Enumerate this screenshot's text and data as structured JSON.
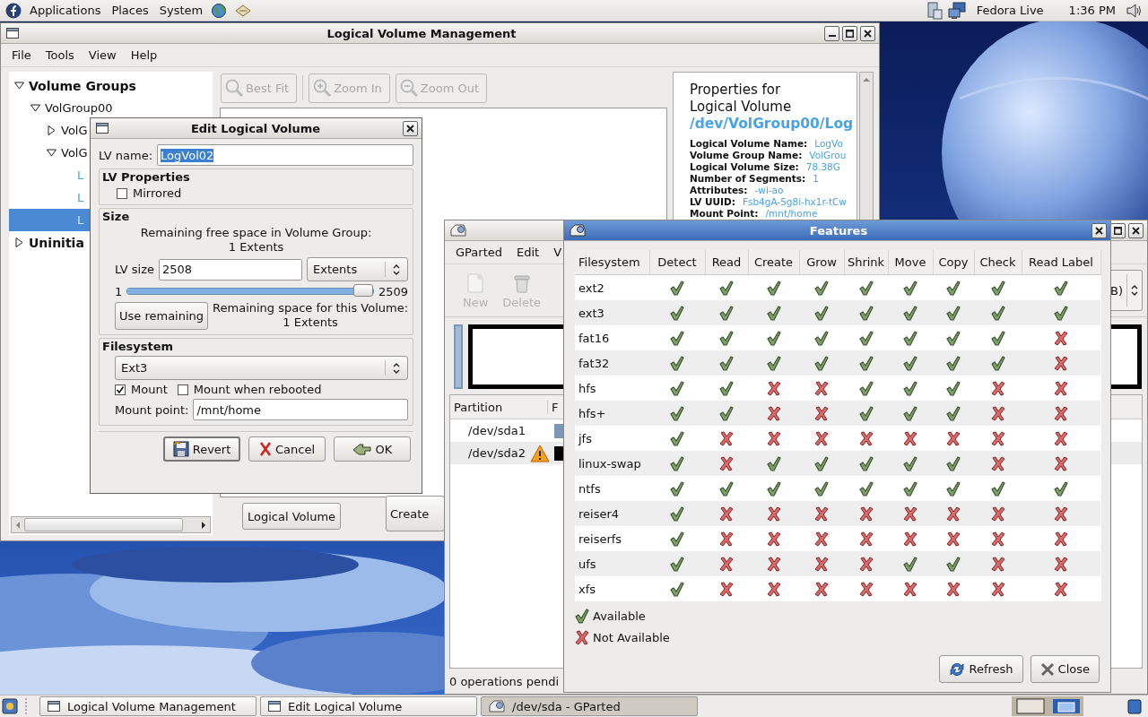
{
  "top_panel": {
    "menus": [
      "Applications",
      "Places",
      "System"
    ],
    "user": "Fedora Live",
    "clock": "1:36 PM"
  },
  "lvm_window": {
    "title": "Logical Volume Management",
    "menu": [
      "File",
      "Tools",
      "View",
      "Help"
    ],
    "tree": [
      {
        "label": "Volume Groups",
        "kind": "category",
        "expanded": true,
        "selected": false,
        "children": [
          {
            "label": "VolGroup00",
            "kind": "group",
            "expanded": true,
            "selected": false,
            "children": [
              {
                "label": "VolG",
                "kind": "group",
                "expanded": false,
                "selected": false
              },
              {
                "label": "VolG",
                "kind": "group",
                "expanded": true,
                "selected": false,
                "children": [
                  {
                    "label": "L",
                    "kind": "volume",
                    "selected": false
                  },
                  {
                    "label": "L",
                    "kind": "volume",
                    "selected": false
                  },
                  {
                    "label": "L",
                    "kind": "volume",
                    "selected": true
                  }
                ]
              }
            ]
          }
        ]
      },
      {
        "label": "Uninitia",
        "kind": "category",
        "expanded": false,
        "selected": false
      }
    ],
    "toolbar": [
      {
        "label": "Best Fit",
        "disabled": true
      },
      {
        "label": "Zoom In",
        "disabled": true
      },
      {
        "label": "Zoom Out",
        "disabled": true
      }
    ],
    "properties": {
      "heading_lines": [
        "Properties for",
        "Logical Volume"
      ],
      "path": "/dev/VolGroup00/Log",
      "fields": [
        {
          "label": "Logical Volume Name:",
          "value": "LogVo"
        },
        {
          "label": "Volume Group Name:",
          "value": "VolGrou"
        },
        {
          "label": "Logical Volume Size:",
          "value": "78.38G"
        },
        {
          "label": "Number of Segments:",
          "value": "1"
        },
        {
          "label": "Attributes:",
          "value": "-wi-ao"
        },
        {
          "label": "LV UUID:",
          "value": "Fsb4gA-5g8i-hx1r-tCw"
        },
        {
          "label": "Mount Point:",
          "value": "/mnt/home"
        }
      ]
    },
    "buttons": [
      "Logical Volume",
      "Create"
    ]
  },
  "edit_dialog": {
    "title": "Edit Logical Volume",
    "lv_name_label": "LV name:",
    "lv_name": "LogVol02",
    "properties_heading": "LV Properties",
    "mirrored": {
      "label": "Mirrored",
      "checked": false
    },
    "size_heading": "Size",
    "free_space": [
      "Remaining free space in Volume Group:",
      "1 Extents"
    ],
    "lv_size_label": "LV size",
    "lv_size": "2508",
    "unit": "Extents",
    "slider_min": "1",
    "slider_max": "2509",
    "level": 1,
    "use_remaining": "Use remaining",
    "remaining_space": [
      "Remaining space for this Volume:",
      "1 Extents"
    ],
    "filesystem_heading": "Filesystem",
    "filesystem": "Ext3",
    "mount": {
      "label": "Mount",
      "checked": true
    },
    "mount_reboot": {
      "label": "Mount when rebooted",
      "checked": false
    },
    "mount_point_label": "Mount point:",
    "mount_point": "/mnt/home",
    "buttons": [
      "Revert",
      "Cancel",
      "OK"
    ]
  },
  "gparted_window": {
    "menu": [
      "GParted",
      "Edit",
      "V"
    ],
    "toolbar": [
      {
        "label": "New",
        "disabled": true
      },
      {
        "label": "Delete",
        "disabled": true
      }
    ],
    "device_combo": "B)",
    "columns": [
      "Partition",
      "F"
    ],
    "partitions": [
      {
        "name": "/dev/sda1",
        "warning": false,
        "color": "#7b96b8"
      },
      {
        "name": "/dev/sda2",
        "warning": true,
        "color": "#000000"
      }
    ],
    "status": "0 operations pendi"
  },
  "features_dialog": {
    "title": "Features",
    "columns": [
      "Filesystem",
      "Detect",
      "Read",
      "Create",
      "Grow",
      "Shrink",
      "Move",
      "Copy",
      "Check",
      "Read Label"
    ],
    "rows": [
      {
        "filesystem": "ext2",
        "available": [
          true,
          true,
          true,
          true,
          true,
          true,
          true,
          true,
          true
        ]
      },
      {
        "filesystem": "ext3",
        "available": [
          true,
          true,
          true,
          true,
          true,
          true,
          true,
          true,
          true
        ]
      },
      {
        "filesystem": "fat16",
        "available": [
          true,
          true,
          true,
          true,
          true,
          true,
          true,
          true,
          false
        ]
      },
      {
        "filesystem": "fat32",
        "available": [
          true,
          true,
          true,
          true,
          true,
          true,
          true,
          true,
          false
        ]
      },
      {
        "filesystem": "hfs",
        "available": [
          true,
          true,
          false,
          false,
          true,
          true,
          true,
          false,
          false
        ]
      },
      {
        "filesystem": "hfs+",
        "available": [
          true,
          true,
          false,
          false,
          true,
          true,
          true,
          false,
          false
        ]
      },
      {
        "filesystem": "jfs",
        "available": [
          true,
          false,
          false,
          false,
          false,
          false,
          false,
          false,
          false
        ]
      },
      {
        "filesystem": "linux-swap",
        "available": [
          true,
          false,
          true,
          true,
          true,
          true,
          true,
          false,
          false
        ]
      },
      {
        "filesystem": "ntfs",
        "available": [
          true,
          true,
          true,
          true,
          true,
          true,
          true,
          true,
          true
        ]
      },
      {
        "filesystem": "reiser4",
        "available": [
          true,
          false,
          false,
          false,
          false,
          false,
          false,
          false,
          false
        ]
      },
      {
        "filesystem": "reiserfs",
        "available": [
          true,
          false,
          false,
          false,
          false,
          false,
          false,
          false,
          false
        ]
      },
      {
        "filesystem": "ufs",
        "available": [
          true,
          false,
          false,
          false,
          false,
          true,
          true,
          false,
          false
        ]
      },
      {
        "filesystem": "xfs",
        "available": [
          true,
          false,
          false,
          false,
          false,
          false,
          false,
          false,
          false
        ]
      }
    ],
    "legend": [
      {
        "label": "Available",
        "available": true
      },
      {
        "label": "Not Available",
        "available": false
      }
    ],
    "buttons": [
      "Refresh",
      "Close"
    ]
  },
  "taskbar": {
    "tasks": [
      {
        "label": "Logical Volume Management",
        "selected": false
      },
      {
        "label": "Edit Logical Volume",
        "selected": false
      },
      {
        "label": "/dev/sda - GParted",
        "selected": true
      }
    ]
  }
}
